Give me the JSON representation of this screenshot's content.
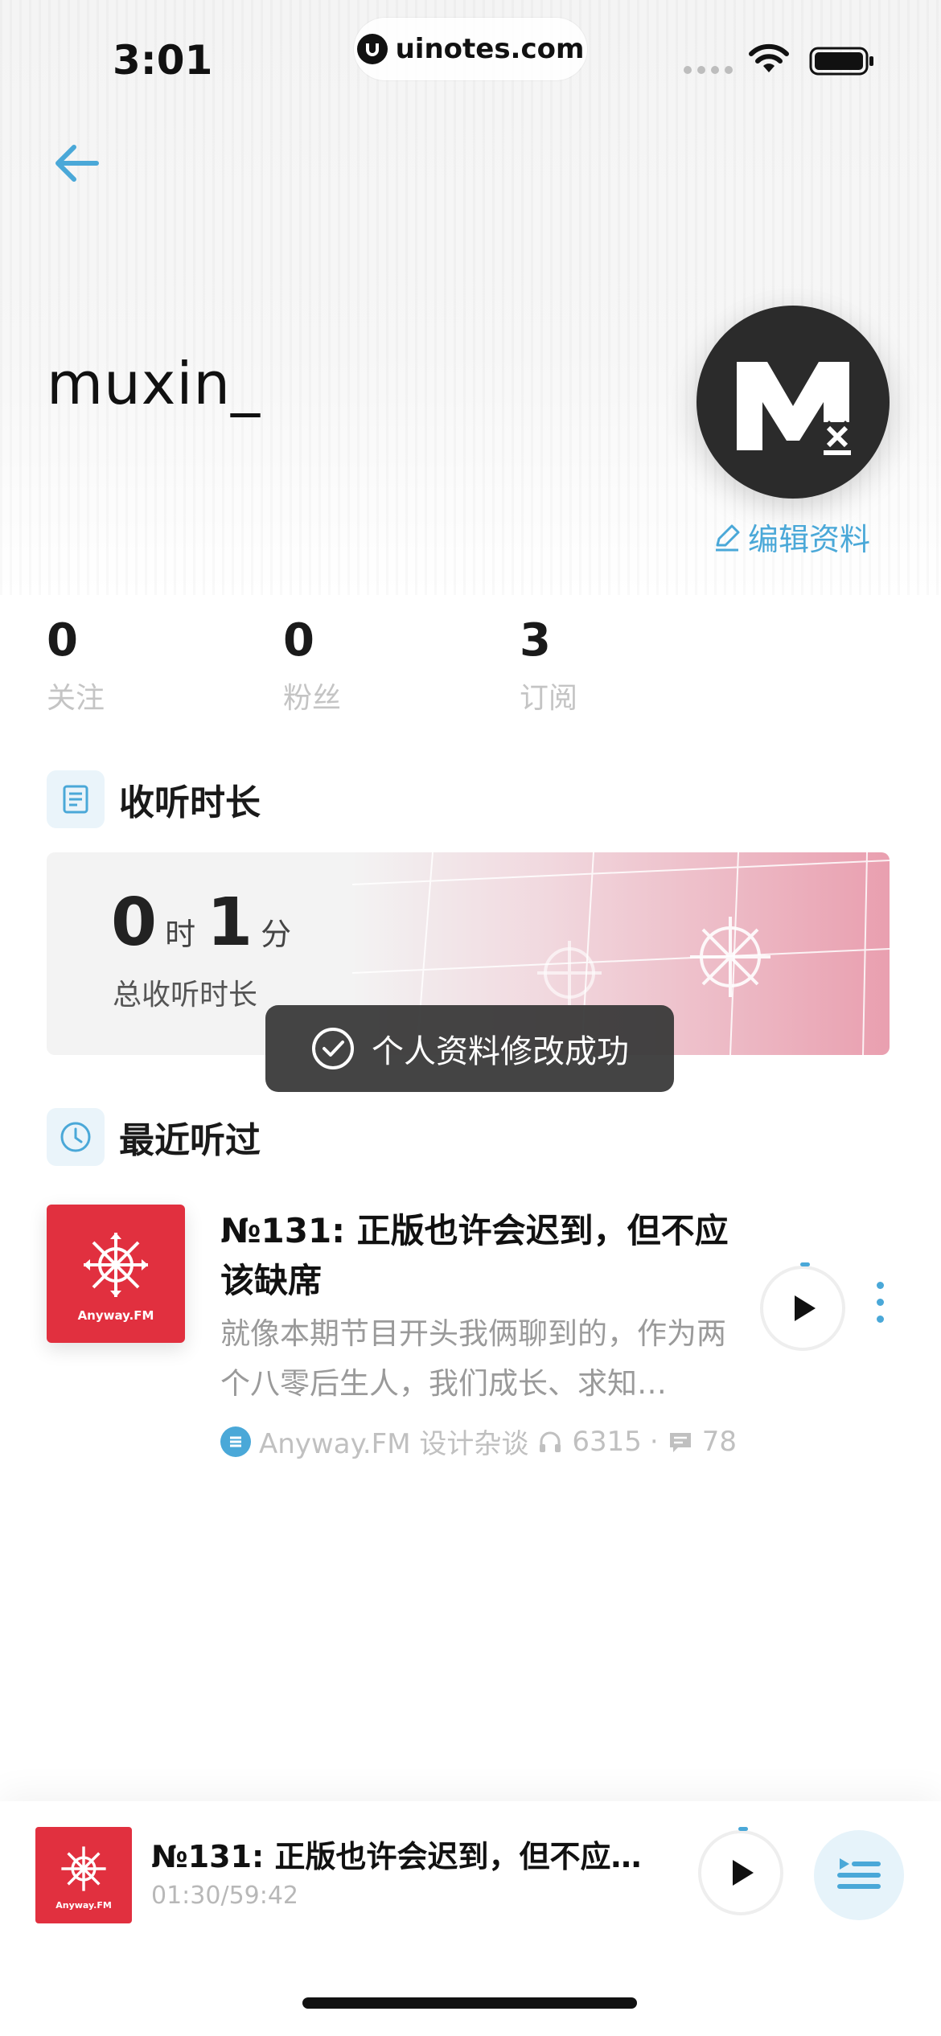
{
  "status_bar": {
    "time": "3:01",
    "url": "uinotes.com"
  },
  "profile": {
    "username": "muxin_",
    "edit_label": "编辑资料",
    "stats": [
      {
        "value": "0",
        "label": "关注"
      },
      {
        "value": "0",
        "label": "粉丝"
      },
      {
        "value": "3",
        "label": "订阅"
      }
    ]
  },
  "listening": {
    "section_title": "收听时长",
    "hours": "0",
    "hours_unit": "时",
    "minutes": "1",
    "minutes_unit": "分",
    "label": "总收听时长"
  },
  "toast": {
    "text": "个人资料修改成功"
  },
  "recent": {
    "section_title": "最近听过",
    "episode": {
      "title": "№131: 正版也许会迟到，但不应该缺席",
      "description": "就像本期节目开头我俩聊到的，作为两个八零后生人，我们成长、求知…",
      "podcast": "Anyway.FM 设计杂谈",
      "plays": "6315",
      "separator": "·",
      "comments": "78",
      "cover_brand": "Anyway.FM"
    }
  },
  "player": {
    "title": "№131: 正版也许会迟到，但不应该...",
    "time": "01:30/59:42",
    "cover_brand": "Anyway.FM"
  },
  "colors": {
    "accent": "#4aa8d8",
    "cover_red": "#e1303f",
    "toast_bg": "#383838"
  }
}
